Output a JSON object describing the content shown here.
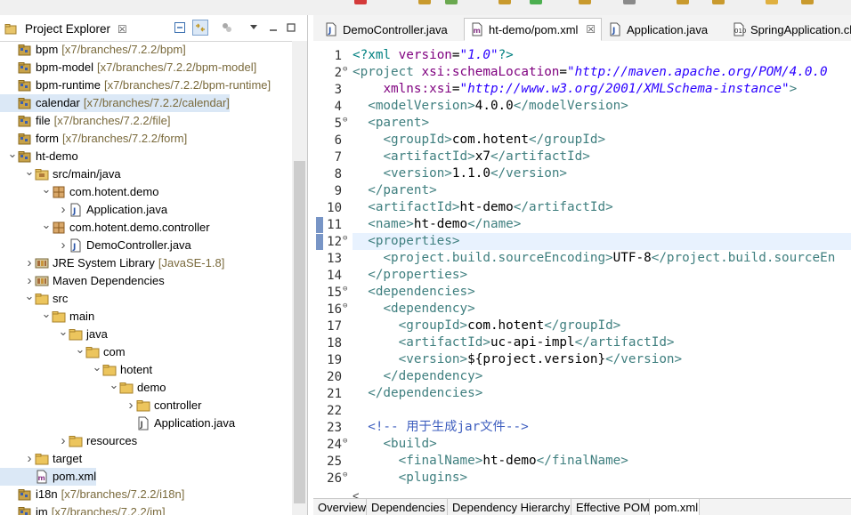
{
  "project_explorer": {
    "title": "Project Explorer",
    "close_glyph": "☒",
    "tree": [
      {
        "label": "bpm",
        "deco": "[x7/branches/7.2.2/bpm]",
        "level": 0,
        "icon": "project-icon",
        "toggle": "none"
      },
      {
        "label": "bpm-model",
        "deco": "[x7/branches/7.2.2/bpm-model]",
        "level": 0,
        "icon": "project-icon",
        "toggle": "none"
      },
      {
        "label": "bpm-runtime",
        "deco": "[x7/branches/7.2.2/bpm-runtime]",
        "level": 0,
        "icon": "project-icon",
        "toggle": "none"
      },
      {
        "label": "calendar",
        "deco": "[x7/branches/7.2.2/calendar]",
        "level": 0,
        "icon": "project-icon",
        "toggle": "none",
        "selected": true
      },
      {
        "label": "file",
        "deco": "[x7/branches/7.2.2/file]",
        "level": 0,
        "icon": "project-icon",
        "toggle": "none"
      },
      {
        "label": "form",
        "deco": "[x7/branches/7.2.2/form]",
        "level": 0,
        "icon": "project-icon",
        "toggle": "none"
      },
      {
        "label": "ht-demo",
        "deco": "",
        "level": 0,
        "icon": "project-icon",
        "toggle": "open"
      },
      {
        "label": "src/main/java",
        "deco": "",
        "level": 1,
        "icon": "source-folder-icon",
        "toggle": "open"
      },
      {
        "label": "com.hotent.demo",
        "deco": "",
        "level": 2,
        "icon": "package-icon",
        "toggle": "open"
      },
      {
        "label": "Application.java",
        "deco": "",
        "level": 3,
        "icon": "java-file-icon",
        "toggle": "closed"
      },
      {
        "label": "com.hotent.demo.controller",
        "deco": "",
        "level": 2,
        "icon": "package-icon",
        "toggle": "open"
      },
      {
        "label": "DemoController.java",
        "deco": "",
        "level": 3,
        "icon": "java-file-icon",
        "toggle": "closed"
      },
      {
        "label": "JRE System Library",
        "deco": "[JavaSE-1.8]",
        "level": 1,
        "icon": "library-icon",
        "toggle": "closed"
      },
      {
        "label": "Maven Dependencies",
        "deco": "",
        "level": 1,
        "icon": "library-icon",
        "toggle": "closed"
      },
      {
        "label": "src",
        "deco": "",
        "level": 1,
        "icon": "folder-icon",
        "toggle": "open"
      },
      {
        "label": "main",
        "deco": "",
        "level": 2,
        "icon": "folder-icon",
        "toggle": "open"
      },
      {
        "label": "java",
        "deco": "",
        "level": 3,
        "icon": "folder-icon",
        "toggle": "open"
      },
      {
        "label": "com",
        "deco": "",
        "level": 4,
        "icon": "folder-icon",
        "toggle": "open"
      },
      {
        "label": "hotent",
        "deco": "",
        "level": 5,
        "icon": "folder-icon",
        "toggle": "open"
      },
      {
        "label": "demo",
        "deco": "",
        "level": 6,
        "icon": "folder-icon",
        "toggle": "open"
      },
      {
        "label": "controller",
        "deco": "",
        "level": 7,
        "icon": "folder-icon",
        "toggle": "closed"
      },
      {
        "label": "Application.java",
        "deco": "",
        "level": 7,
        "icon": "java-text-file-icon",
        "toggle": "none"
      },
      {
        "label": "resources",
        "deco": "",
        "level": 3,
        "icon": "folder-icon",
        "toggle": "closed"
      },
      {
        "label": "target",
        "deco": "",
        "level": 1,
        "icon": "folder-icon",
        "toggle": "closed"
      },
      {
        "label": "pom.xml",
        "deco": "",
        "level": 1,
        "icon": "xml-file-icon",
        "toggle": "none",
        "selected": true
      },
      {
        "label": "i18n",
        "deco": "[x7/branches/7.2.2/i18n]",
        "level": 0,
        "icon": "project-icon",
        "toggle": "none"
      },
      {
        "label": "im",
        "deco": "[x7/branches/7.2.2/im]",
        "level": 0,
        "icon": "project-icon",
        "toggle": "none"
      }
    ]
  },
  "editor": {
    "tabs": [
      {
        "label": "DemoController.java",
        "icon": "java-file-icon",
        "active": false
      },
      {
        "label": "ht-demo/pom.xml",
        "icon": "xml-file-icon",
        "active": true
      },
      {
        "label": "Application.java",
        "icon": "java-file-icon",
        "active": false
      },
      {
        "label": "SpringApplication.cla",
        "icon": "class-file-icon",
        "active": false
      }
    ],
    "close_glyph": "☒",
    "lines": [
      {
        "n": "1",
        "fold": "",
        "marker": false,
        "current": false,
        "tokens": [
          [
            "pi",
            "<?xml "
          ],
          [
            "attr",
            "version"
          ],
          [
            "txt",
            "="
          ],
          [
            "str",
            "\"1.0\""
          ],
          [
            "pi",
            "?>"
          ]
        ]
      },
      {
        "n": "2",
        "fold": "⊖",
        "marker": false,
        "current": false,
        "tokens": [
          [
            "tag",
            "<project "
          ],
          [
            "attr",
            "xsi:schemaLocation"
          ],
          [
            "txt",
            "="
          ],
          [
            "str",
            "\"http://maven.apache.org/POM/4.0.0"
          ]
        ]
      },
      {
        "n": "3",
        "fold": "",
        "marker": false,
        "current": false,
        "tokens": [
          [
            "txt",
            "    "
          ],
          [
            "attr",
            "xmlns:xsi"
          ],
          [
            "txt",
            "="
          ],
          [
            "str",
            "\"http://www.w3.org/2001/XMLSchema-instance\""
          ],
          [
            "tag",
            ">"
          ]
        ]
      },
      {
        "n": "4",
        "fold": "",
        "marker": false,
        "current": false,
        "tokens": [
          [
            "txt",
            "  "
          ],
          [
            "tag",
            "<modelVersion>"
          ],
          [
            "txt",
            "4.0.0"
          ],
          [
            "tag",
            "</modelVersion>"
          ]
        ]
      },
      {
        "n": "5",
        "fold": "⊖",
        "marker": false,
        "current": false,
        "tokens": [
          [
            "txt",
            "  "
          ],
          [
            "tag",
            "<parent>"
          ]
        ]
      },
      {
        "n": "6",
        "fold": "",
        "marker": false,
        "current": false,
        "tokens": [
          [
            "txt",
            "    "
          ],
          [
            "tag",
            "<groupId>"
          ],
          [
            "txt",
            "com.hotent"
          ],
          [
            "tag",
            "</groupId>"
          ]
        ]
      },
      {
        "n": "7",
        "fold": "",
        "marker": false,
        "current": false,
        "tokens": [
          [
            "txt",
            "    "
          ],
          [
            "tag",
            "<artifactId>"
          ],
          [
            "txt",
            "x7"
          ],
          [
            "tag",
            "</artifactId>"
          ]
        ]
      },
      {
        "n": "8",
        "fold": "",
        "marker": false,
        "current": false,
        "tokens": [
          [
            "txt",
            "    "
          ],
          [
            "tag",
            "<version>"
          ],
          [
            "txt",
            "1.1.0"
          ],
          [
            "tag",
            "</version>"
          ]
        ]
      },
      {
        "n": "9",
        "fold": "",
        "marker": false,
        "current": false,
        "tokens": [
          [
            "txt",
            "  "
          ],
          [
            "tag",
            "</parent>"
          ]
        ]
      },
      {
        "n": "10",
        "fold": "",
        "marker": false,
        "current": false,
        "tokens": [
          [
            "txt",
            "  "
          ],
          [
            "tag",
            "<artifactId>"
          ],
          [
            "txt",
            "ht-demo"
          ],
          [
            "tag",
            "</artifactId>"
          ]
        ]
      },
      {
        "n": "11",
        "fold": "",
        "marker": true,
        "current": false,
        "tokens": [
          [
            "txt",
            "  "
          ],
          [
            "tag",
            "<name>"
          ],
          [
            "txt",
            "ht-demo"
          ],
          [
            "tag",
            "</name>"
          ]
        ]
      },
      {
        "n": "12",
        "fold": "⊖",
        "marker": true,
        "current": true,
        "tokens": [
          [
            "txt",
            "  "
          ],
          [
            "tag",
            "<properties>"
          ]
        ]
      },
      {
        "n": "13",
        "fold": "",
        "marker": false,
        "current": false,
        "tokens": [
          [
            "txt",
            "    "
          ],
          [
            "tag",
            "<project.build.sourceEncoding>"
          ],
          [
            "txt",
            "UTF-8"
          ],
          [
            "tag",
            "</project.build.sourceEn"
          ]
        ]
      },
      {
        "n": "14",
        "fold": "",
        "marker": false,
        "current": false,
        "tokens": [
          [
            "txt",
            "  "
          ],
          [
            "tag",
            "</properties>"
          ]
        ]
      },
      {
        "n": "15",
        "fold": "⊖",
        "marker": false,
        "current": false,
        "tokens": [
          [
            "txt",
            "  "
          ],
          [
            "tag",
            "<dependencies>"
          ]
        ]
      },
      {
        "n": "16",
        "fold": "⊖",
        "marker": false,
        "current": false,
        "tokens": [
          [
            "txt",
            "    "
          ],
          [
            "tag",
            "<dependency>"
          ]
        ]
      },
      {
        "n": "17",
        "fold": "",
        "marker": false,
        "current": false,
        "tokens": [
          [
            "txt",
            "      "
          ],
          [
            "tag",
            "<groupId>"
          ],
          [
            "txt",
            "com.hotent"
          ],
          [
            "tag",
            "</groupId>"
          ]
        ]
      },
      {
        "n": "18",
        "fold": "",
        "marker": false,
        "current": false,
        "tokens": [
          [
            "txt",
            "      "
          ],
          [
            "tag",
            "<artifactId>"
          ],
          [
            "txt",
            "uc-api-impl"
          ],
          [
            "tag",
            "</artifactId>"
          ]
        ]
      },
      {
        "n": "19",
        "fold": "",
        "marker": false,
        "current": false,
        "tokens": [
          [
            "txt",
            "      "
          ],
          [
            "tag",
            "<version>"
          ],
          [
            "txt",
            "${project.version}"
          ],
          [
            "tag",
            "</version>"
          ]
        ]
      },
      {
        "n": "20",
        "fold": "",
        "marker": false,
        "current": false,
        "tokens": [
          [
            "txt",
            "    "
          ],
          [
            "tag",
            "</dependency>"
          ]
        ]
      },
      {
        "n": "21",
        "fold": "",
        "marker": false,
        "current": false,
        "tokens": [
          [
            "txt",
            "  "
          ],
          [
            "tag",
            "</dependencies>"
          ]
        ]
      },
      {
        "n": "22",
        "fold": "",
        "marker": false,
        "current": false,
        "tokens": []
      },
      {
        "n": "23",
        "fold": "",
        "marker": false,
        "current": false,
        "tokens": [
          [
            "txt",
            "  "
          ],
          [
            "cmt",
            "<!-- 用于生成jar文件-->"
          ]
        ]
      },
      {
        "n": "24",
        "fold": "⊖",
        "marker": false,
        "current": false,
        "tokens": [
          [
            "txt",
            "    "
          ],
          [
            "tag",
            "<build>"
          ]
        ]
      },
      {
        "n": "25",
        "fold": "",
        "marker": false,
        "current": false,
        "tokens": [
          [
            "txt",
            "      "
          ],
          [
            "tag",
            "<finalName>"
          ],
          [
            "txt",
            "ht-demo"
          ],
          [
            "tag",
            "</finalName>"
          ]
        ]
      },
      {
        "n": "26",
        "fold": "⊖",
        "marker": false,
        "current": false,
        "tokens": [
          [
            "txt",
            "      "
          ],
          [
            "tag",
            "<plugins>"
          ]
        ]
      }
    ],
    "bottom_tabs": [
      {
        "label": "Overview",
        "active": false
      },
      {
        "label": "Dependencies",
        "active": false
      },
      {
        "label": "Dependency Hierarchy",
        "active": false
      },
      {
        "label": "Effective POM",
        "active": false
      },
      {
        "label": "pom.xml",
        "active": true
      }
    ],
    "scroll_left_glyph": "<"
  }
}
